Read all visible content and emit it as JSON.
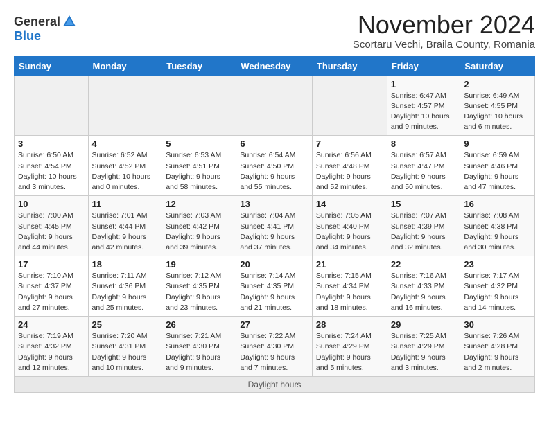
{
  "header": {
    "logo_general": "General",
    "logo_blue": "Blue",
    "month_title": "November 2024",
    "subtitle": "Scortaru Vechi, Braila County, Romania"
  },
  "days_of_week": [
    "Sunday",
    "Monday",
    "Tuesday",
    "Wednesday",
    "Thursday",
    "Friday",
    "Saturday"
  ],
  "weeks": [
    [
      {
        "day": "",
        "detail": ""
      },
      {
        "day": "",
        "detail": ""
      },
      {
        "day": "",
        "detail": ""
      },
      {
        "day": "",
        "detail": ""
      },
      {
        "day": "",
        "detail": ""
      },
      {
        "day": "1",
        "detail": "Sunrise: 6:47 AM\nSunset: 4:57 PM\nDaylight: 10 hours and 9 minutes."
      },
      {
        "day": "2",
        "detail": "Sunrise: 6:49 AM\nSunset: 4:55 PM\nDaylight: 10 hours and 6 minutes."
      }
    ],
    [
      {
        "day": "3",
        "detail": "Sunrise: 6:50 AM\nSunset: 4:54 PM\nDaylight: 10 hours and 3 minutes."
      },
      {
        "day": "4",
        "detail": "Sunrise: 6:52 AM\nSunset: 4:52 PM\nDaylight: 10 hours and 0 minutes."
      },
      {
        "day": "5",
        "detail": "Sunrise: 6:53 AM\nSunset: 4:51 PM\nDaylight: 9 hours and 58 minutes."
      },
      {
        "day": "6",
        "detail": "Sunrise: 6:54 AM\nSunset: 4:50 PM\nDaylight: 9 hours and 55 minutes."
      },
      {
        "day": "7",
        "detail": "Sunrise: 6:56 AM\nSunset: 4:48 PM\nDaylight: 9 hours and 52 minutes."
      },
      {
        "day": "8",
        "detail": "Sunrise: 6:57 AM\nSunset: 4:47 PM\nDaylight: 9 hours and 50 minutes."
      },
      {
        "day": "9",
        "detail": "Sunrise: 6:59 AM\nSunset: 4:46 PM\nDaylight: 9 hours and 47 minutes."
      }
    ],
    [
      {
        "day": "10",
        "detail": "Sunrise: 7:00 AM\nSunset: 4:45 PM\nDaylight: 9 hours and 44 minutes."
      },
      {
        "day": "11",
        "detail": "Sunrise: 7:01 AM\nSunset: 4:44 PM\nDaylight: 9 hours and 42 minutes."
      },
      {
        "day": "12",
        "detail": "Sunrise: 7:03 AM\nSunset: 4:42 PM\nDaylight: 9 hours and 39 minutes."
      },
      {
        "day": "13",
        "detail": "Sunrise: 7:04 AM\nSunset: 4:41 PM\nDaylight: 9 hours and 37 minutes."
      },
      {
        "day": "14",
        "detail": "Sunrise: 7:05 AM\nSunset: 4:40 PM\nDaylight: 9 hours and 34 minutes."
      },
      {
        "day": "15",
        "detail": "Sunrise: 7:07 AM\nSunset: 4:39 PM\nDaylight: 9 hours and 32 minutes."
      },
      {
        "day": "16",
        "detail": "Sunrise: 7:08 AM\nSunset: 4:38 PM\nDaylight: 9 hours and 30 minutes."
      }
    ],
    [
      {
        "day": "17",
        "detail": "Sunrise: 7:10 AM\nSunset: 4:37 PM\nDaylight: 9 hours and 27 minutes."
      },
      {
        "day": "18",
        "detail": "Sunrise: 7:11 AM\nSunset: 4:36 PM\nDaylight: 9 hours and 25 minutes."
      },
      {
        "day": "19",
        "detail": "Sunrise: 7:12 AM\nSunset: 4:35 PM\nDaylight: 9 hours and 23 minutes."
      },
      {
        "day": "20",
        "detail": "Sunrise: 7:14 AM\nSunset: 4:35 PM\nDaylight: 9 hours and 21 minutes."
      },
      {
        "day": "21",
        "detail": "Sunrise: 7:15 AM\nSunset: 4:34 PM\nDaylight: 9 hours and 18 minutes."
      },
      {
        "day": "22",
        "detail": "Sunrise: 7:16 AM\nSunset: 4:33 PM\nDaylight: 9 hours and 16 minutes."
      },
      {
        "day": "23",
        "detail": "Sunrise: 7:17 AM\nSunset: 4:32 PM\nDaylight: 9 hours and 14 minutes."
      }
    ],
    [
      {
        "day": "24",
        "detail": "Sunrise: 7:19 AM\nSunset: 4:32 PM\nDaylight: 9 hours and 12 minutes."
      },
      {
        "day": "25",
        "detail": "Sunrise: 7:20 AM\nSunset: 4:31 PM\nDaylight: 9 hours and 10 minutes."
      },
      {
        "day": "26",
        "detail": "Sunrise: 7:21 AM\nSunset: 4:30 PM\nDaylight: 9 hours and 9 minutes."
      },
      {
        "day": "27",
        "detail": "Sunrise: 7:22 AM\nSunset: 4:30 PM\nDaylight: 9 hours and 7 minutes."
      },
      {
        "day": "28",
        "detail": "Sunrise: 7:24 AM\nSunset: 4:29 PM\nDaylight: 9 hours and 5 minutes."
      },
      {
        "day": "29",
        "detail": "Sunrise: 7:25 AM\nSunset: 4:29 PM\nDaylight: 9 hours and 3 minutes."
      },
      {
        "day": "30",
        "detail": "Sunrise: 7:26 AM\nSunset: 4:28 PM\nDaylight: 9 hours and 2 minutes."
      }
    ]
  ],
  "daylight_footer": {
    "label": "Daylight hours"
  }
}
